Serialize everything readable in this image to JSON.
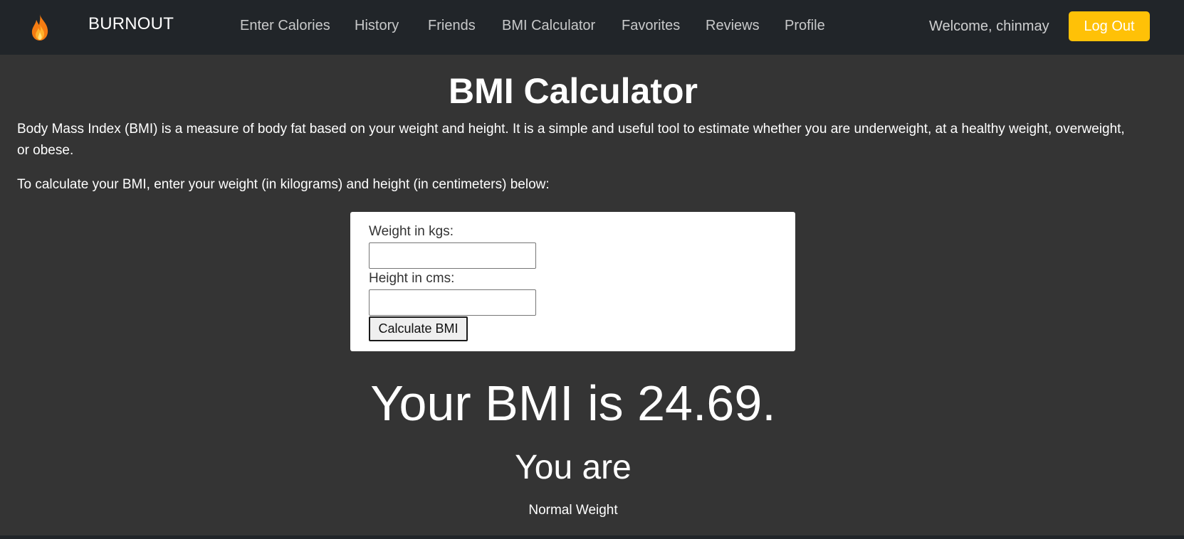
{
  "navbar": {
    "logo_icon": "flame-icon",
    "brand": "BURNOUT",
    "links": [
      {
        "label": "Enter Calories"
      },
      {
        "label": "History"
      },
      {
        "label": "Friends"
      },
      {
        "label": "BMI Calculator"
      },
      {
        "label": "Favorites"
      },
      {
        "label": "Reviews"
      },
      {
        "label": "Profile"
      }
    ],
    "welcome": "Welcome, chinmay",
    "logout_label": "Log Out"
  },
  "page": {
    "title": "BMI Calculator",
    "intro": "Body Mass Index (BMI) is a measure of body fat based on your weight and height. It is a simple and useful tool to estimate whether you are underweight, at a healthy weight, overweight, or obese.",
    "instruction": "To calculate your BMI, enter your weight (in kilograms) and height (in centimeters) below:"
  },
  "form": {
    "weight_label": "Weight in kgs:",
    "weight_value": "",
    "height_label": "Height in cms:",
    "height_value": "",
    "submit_label": "Calculate BMI"
  },
  "result": {
    "bmi_text": "Your BMI is 24.69.",
    "you_are": "You are",
    "category": "Normal Weight"
  },
  "colors": {
    "navbar_bg": "#212529",
    "content_bg": "#343434",
    "accent": "#ffc107"
  }
}
